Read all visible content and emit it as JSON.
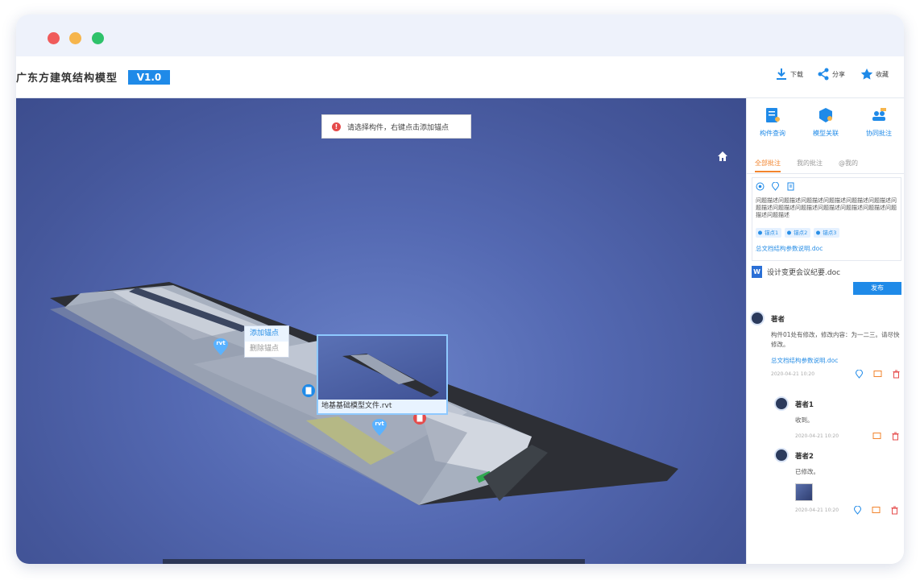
{
  "app": {
    "title": "广东方建筑结构模型",
    "version": "V1.0"
  },
  "toolbar": {
    "download_label": "下载",
    "share_label": "分享",
    "favorite_label": "收藏"
  },
  "viewport": {
    "toast_text": "请选择构件，右键点击添加锚点",
    "context_menu": [
      "添加锚点",
      "删除锚点"
    ],
    "preview_caption": "地基基础模型文件.rvt",
    "pins": [
      "rvt",
      "rvt"
    ]
  },
  "sidebar": {
    "tools": [
      {
        "label": "构件查询",
        "icon": "component-query-icon"
      },
      {
        "label": "模型关联",
        "icon": "model-link-icon"
      },
      {
        "label": "协同批注",
        "icon": "collab-annotation-icon"
      }
    ],
    "tabs": [
      "全部批注",
      "我的批注",
      "@我的"
    ],
    "active_tab": 0,
    "editor": {
      "text": "问题描述问题描述问题描述问题描述问题描述问题描述问题描述问题描述问题描述问题描述问题描述问题描述问题描述问题描述",
      "anchors": [
        "锚点1",
        "锚点2",
        "锚点3"
      ],
      "link": "总文档结构参数说明.doc"
    },
    "attachment": "设计变更会议纪要.doc",
    "publish_label": "发布",
    "comments": [
      {
        "name": "著者",
        "text": "构件01处有修改，修改内容：为一二三。请尽快修改。",
        "link": "总文档结构参数说明.doc",
        "date": "2020-04-21 10:20"
      },
      {
        "name": "著者1",
        "text": "收到。",
        "date": "2020-04-21 10:20"
      },
      {
        "name": "著者2",
        "text": "已修改。",
        "date": "2020-04-21 10:20"
      }
    ]
  },
  "colors": {
    "accent": "#1f8ae8",
    "active_tab": "#f2842e",
    "danger": "#e54b4b",
    "viewport_bg": "#5469b2"
  }
}
